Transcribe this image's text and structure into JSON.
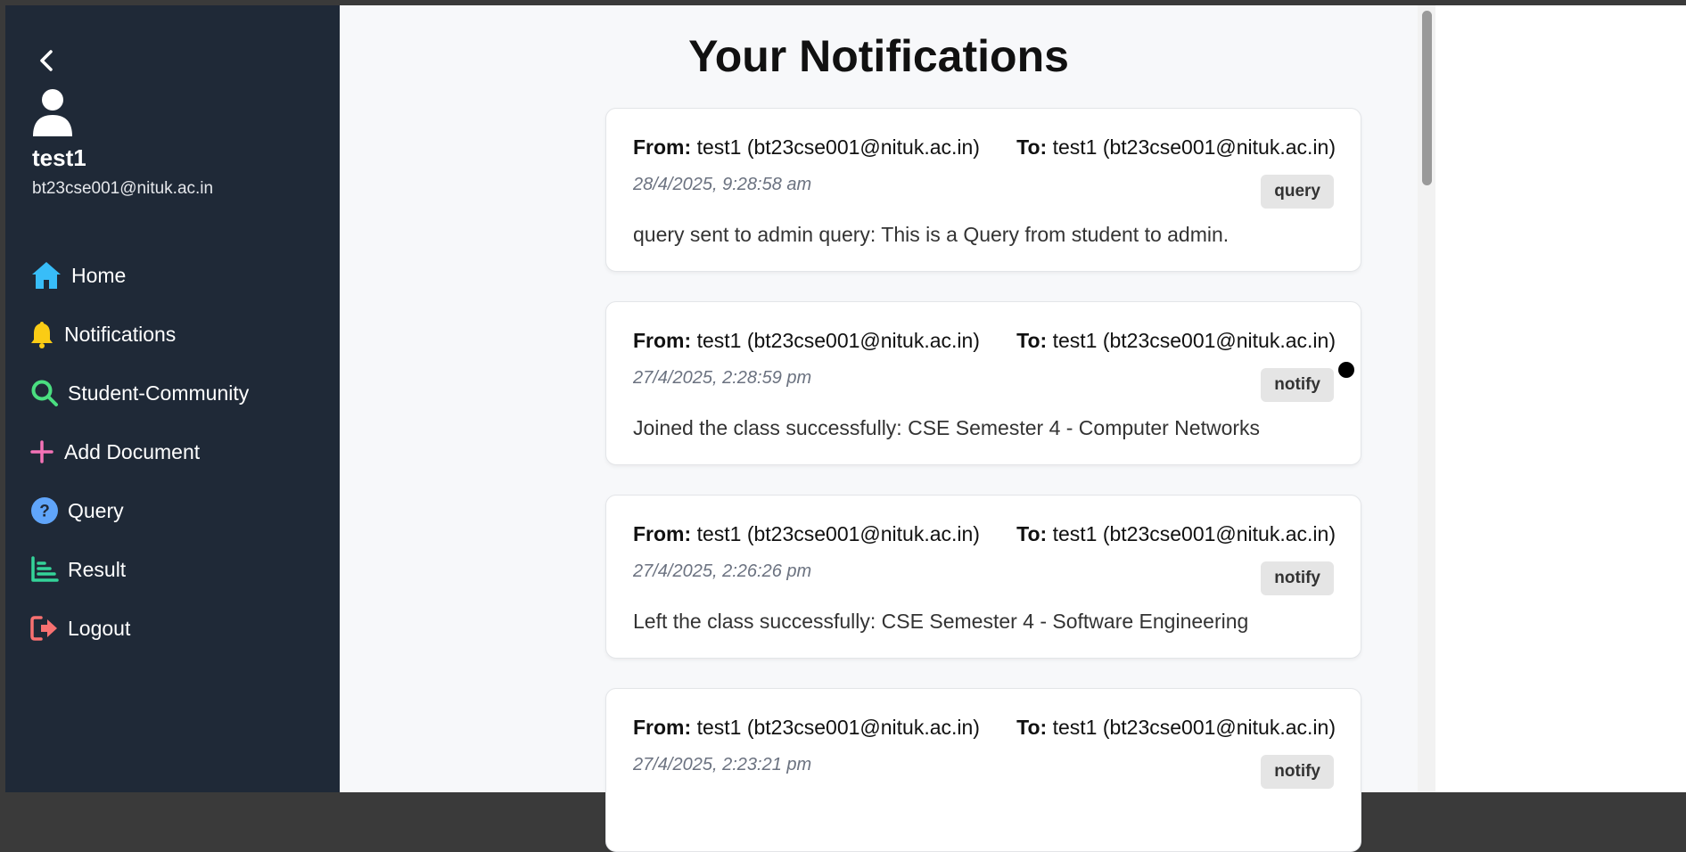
{
  "sidebar": {
    "user_name": "test1",
    "user_email": "bt23cse001@nituk.ac.in",
    "items": [
      {
        "label": "Home",
        "icon": "home-icon",
        "color": "#38bdf8"
      },
      {
        "label": "Notifications",
        "icon": "bell-icon",
        "color": "#facc15"
      },
      {
        "label": "Student-Community",
        "icon": "search-icon",
        "color": "#4ade80"
      },
      {
        "label": "Add Document",
        "icon": "plus-icon",
        "color": "#f472b6"
      },
      {
        "label": "Query",
        "icon": "question-icon",
        "color": "#60a5fa"
      },
      {
        "label": "Result",
        "icon": "chart-icon",
        "color": "#34d399"
      },
      {
        "label": "Logout",
        "icon": "logout-icon",
        "color": "#f87171"
      }
    ]
  },
  "main": {
    "title": "Your Notifications",
    "from_label": "From:",
    "to_label": "To:",
    "notifications": [
      {
        "from": "test1 (bt23cse001@nituk.ac.in)",
        "to": "test1 (bt23cse001@nituk.ac.in)",
        "time": "28/4/2025, 9:28:58 am",
        "type": "query",
        "message": "query sent to admin query: This is a Query from student to admin."
      },
      {
        "from": "test1 (bt23cse001@nituk.ac.in)",
        "to": "test1 (bt23cse001@nituk.ac.in)",
        "time": "27/4/2025, 2:28:59 pm",
        "type": "notify",
        "message": "Joined the class successfully: CSE Semester 4 - Computer Networks"
      },
      {
        "from": "test1 (bt23cse001@nituk.ac.in)",
        "to": "test1 (bt23cse001@nituk.ac.in)",
        "time": "27/4/2025, 2:26:26 pm",
        "type": "notify",
        "message": "Left the class successfully: CSE Semester 4 - Software Engineering"
      },
      {
        "from": "test1 (bt23cse001@nituk.ac.in)",
        "to": "test1 (bt23cse001@nituk.ac.in)",
        "time": "27/4/2025, 2:23:21 pm",
        "type": "notify",
        "message": ""
      }
    ]
  },
  "colors": {
    "sidebar_bg": "#1f2937",
    "page_bg": "#f7f8fa",
    "badge_bg": "#e5e5e5"
  }
}
